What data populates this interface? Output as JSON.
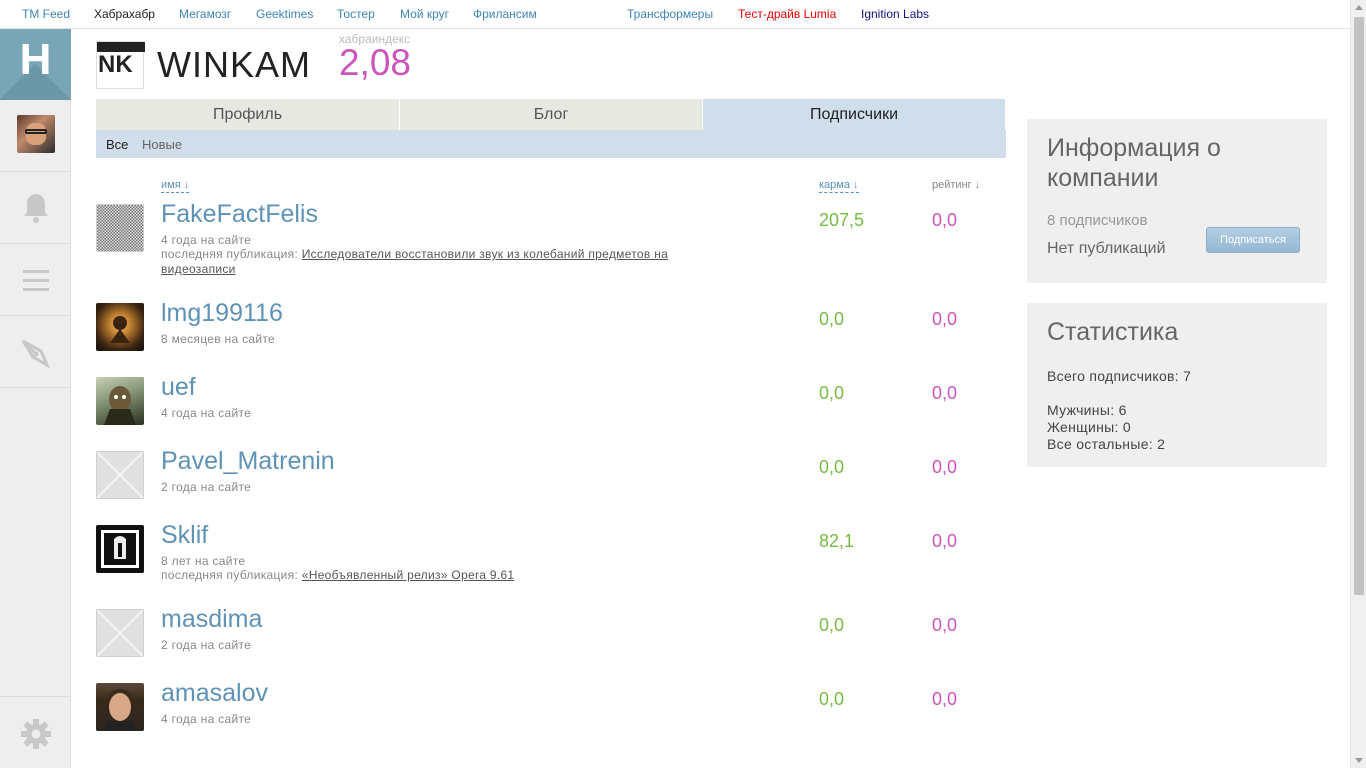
{
  "topnav": {
    "items": [
      "TM Feed",
      "Хабрахабр",
      "Мегамозг",
      "Geektimes",
      "Тостер",
      "Мой круг",
      "Фрилансим",
      "Трансформеры",
      "Тест-драйв Lumia",
      "Ignition Labs"
    ],
    "active_index": 1
  },
  "sidebar": {
    "logo_letter": "H",
    "icons": [
      "bell-icon",
      "menu-icon",
      "pen-icon",
      "gear-icon"
    ]
  },
  "company": {
    "logo_text": "NK",
    "name": "WINKAM",
    "habraindex_label": "хабраиндекс",
    "habraindex_value": "2,08"
  },
  "tabs": [
    "Профиль",
    "Блог",
    "Подписчики"
  ],
  "active_tab": 2,
  "subtabs": {
    "all": "Все",
    "new": "Новые"
  },
  "columns": {
    "name": "имя ↓",
    "karma": "карма ↓",
    "rating": "рейтинг ↓"
  },
  "users": [
    {
      "name": "FakeFactFelis",
      "since": "4 года на сайте",
      "last_pub_label": "последняя публикация: ",
      "last_pub": "Исследователи восстановили звук из колебаний предметов на видеозаписи",
      "karma": "207,5",
      "rating": "0,0"
    },
    {
      "name": "lmg199116",
      "since": "8 месяцев на сайте",
      "karma": "0,0",
      "rating": "0,0"
    },
    {
      "name": "uef",
      "since": "4 года на сайте",
      "karma": "0,0",
      "rating": "0,0"
    },
    {
      "name": "Pavel_Matrenin",
      "since": "2 года на сайте",
      "karma": "0,0",
      "rating": "0,0"
    },
    {
      "name": "Sklif",
      "since": "8 лет на сайте",
      "last_pub_label": "последняя публикация: ",
      "last_pub": "«Необъявленный релиз» Opera 9.61",
      "karma": "82,1",
      "rating": "0,0"
    },
    {
      "name": "masdima",
      "since": "2 года на сайте",
      "karma": "0,0",
      "rating": "0,0"
    },
    {
      "name": "amasalov",
      "since": "4 года на сайте",
      "karma": "0,0",
      "rating": "0,0"
    }
  ],
  "info": {
    "title": "Информация о компании",
    "subscribers": "8 подписчиков",
    "publications": "Нет публикаций",
    "subscribe_button": "Подписаться"
  },
  "stats": {
    "title": "Статистика",
    "total": "Всего подписчиков: 7",
    "men": "Мужчины: 6",
    "women": "Женщины: 0",
    "others": "Все остальные: 2"
  },
  "colors": {
    "karma": "#77bb44",
    "rating": "#cc55bb",
    "link": "#5e93b6",
    "accent_tab": "#cfdeea"
  }
}
